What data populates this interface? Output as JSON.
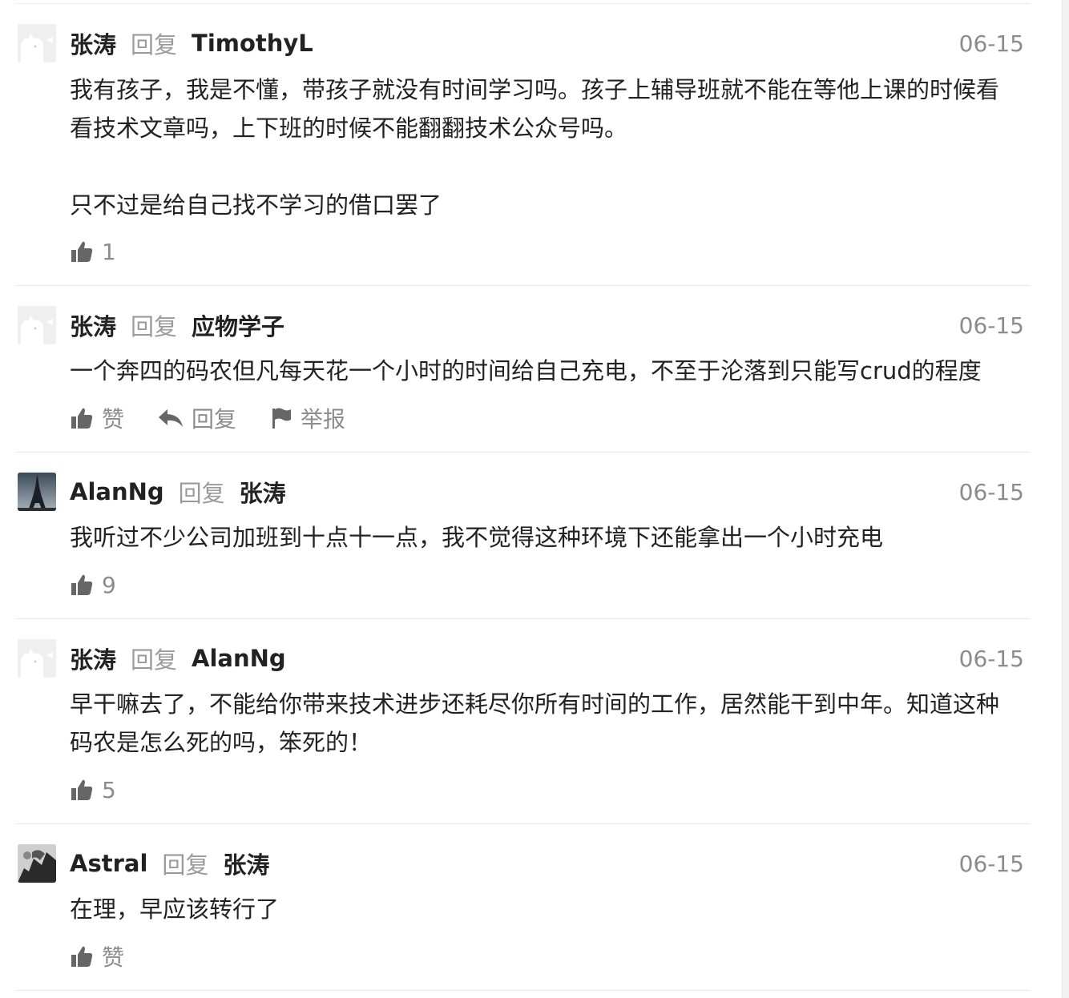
{
  "comments": [
    {
      "author": "张涛",
      "reply_word": "回复",
      "target": "TimothyL",
      "date": "06-15",
      "lines": [
        "我有孩子，我是不懂，带孩子就没有时间学习吗。孩子上辅导班就不能在等他上课的时候看",
        "看技术文章吗，上下班的时候不能翻翻技术公众号吗。"
      ],
      "lines2": [
        "只不过是给自己找不学习的借口罢了"
      ],
      "like_text": "1",
      "avatar_icon": "cat-avatar-icon"
    },
    {
      "author": "张涛",
      "reply_word": "回复",
      "target": "应物学子",
      "date": "06-15",
      "lines": [
        "一个奔四的码农但凡每天花一个小时的时间给自己充电，不至于沦落到只能写crud的程度"
      ],
      "like_text": "赞",
      "reply_text": "回复",
      "report_text": "举报",
      "avatar_icon": "cat-avatar-icon"
    },
    {
      "author": "AlanNg",
      "reply_word": "回复",
      "target": "张涛",
      "date": "06-15",
      "lines": [
        "我听过不少公司加班到十点十一点，我不觉得这种环境下还能拿出一个小时充电"
      ],
      "like_text": "9",
      "avatar_icon": "eiffel-tower-avatar-icon"
    },
    {
      "author": "张涛",
      "reply_word": "回复",
      "target": "AlanNg",
      "date": "06-15",
      "lines": [
        "早干嘛去了，不能给你带来技术进步还耗尽你所有时间的工作，居然能干到中年。知道这种",
        "码农是怎么死的吗，笨死的！"
      ],
      "like_text": "5",
      "avatar_icon": "cat-avatar-icon"
    },
    {
      "author": "Astral",
      "reply_word": "回复",
      "target": "张涛",
      "date": "06-15",
      "lines": [
        "在理，早应该转行了"
      ],
      "like_text": "赞",
      "avatar_icon": "bw-photo-avatar-icon"
    }
  ]
}
